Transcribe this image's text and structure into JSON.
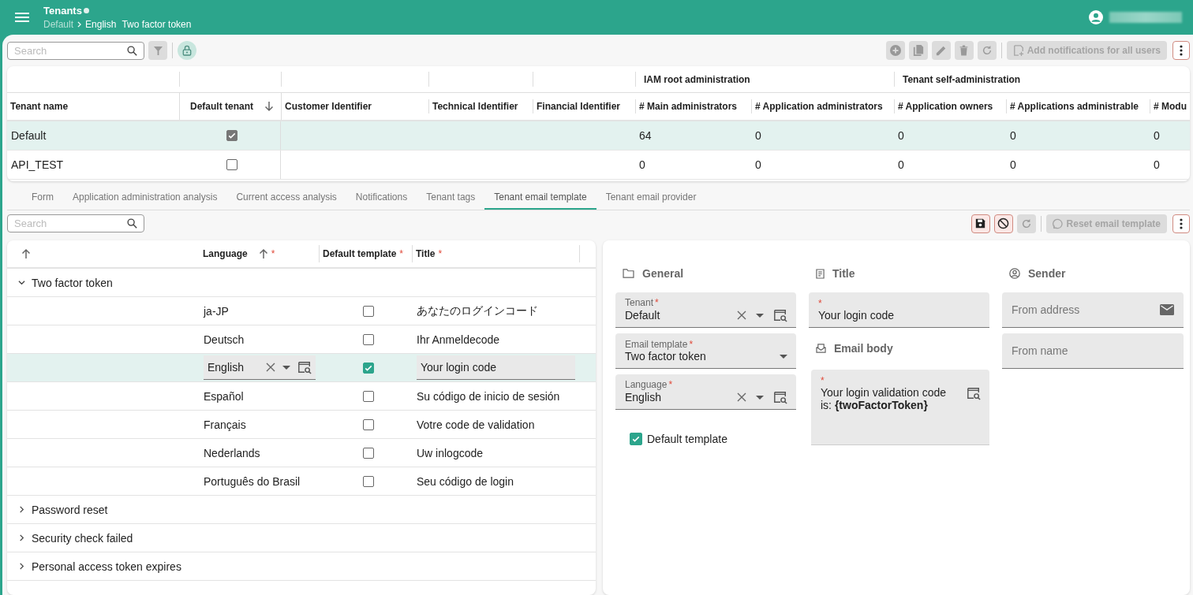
{
  "app_bar": {
    "title": "Tenants",
    "modified": true,
    "breadcrumb": [
      "Default",
      "English"
    ],
    "record": "Two factor token"
  },
  "toolbar": {
    "search": {
      "placeholder": "Search"
    },
    "filter": {
      "disabled": true
    },
    "lock": {
      "locked": true
    },
    "actions": [
      {
        "kind": "add",
        "disabled": true
      },
      {
        "kind": "copy",
        "disabled": true
      },
      {
        "kind": "edit",
        "disabled": true
      },
      {
        "kind": "delete",
        "disabled": true
      },
      {
        "kind": "refresh",
        "disabled": true
      }
    ],
    "add_notifications": {
      "label": "Add notifications for all users",
      "disabled": true
    }
  },
  "tenants_table": {
    "column_groups": [
      {
        "columns": [
          {
            "label": "Tenant name"
          }
        ]
      },
      {
        "columns": [
          {
            "label": "Default tenant",
            "sort_descending": true
          }
        ]
      },
      {
        "columns": [
          {
            "label": "Customer Identifier"
          }
        ]
      },
      {
        "columns": [
          {
            "label": "Technical Identifier"
          }
        ]
      },
      {
        "columns": [
          {
            "label": "Financial Identifier"
          }
        ]
      },
      {
        "label": "IAM root administration",
        "columns": [
          {
            "label": "# Main administrators"
          },
          {
            "label": "# Application administrators"
          }
        ]
      },
      {
        "label": "Tenant self-administration",
        "columns": [
          {
            "label": "# Application owners"
          },
          {
            "label": "# Applications administrable"
          },
          {
            "label": "# Modu"
          }
        ]
      }
    ],
    "rows": [
      {
        "tenant_name": "Default",
        "default_tenant": true,
        "selected": true,
        "main_administrators": "64",
        "application_administrators": "0",
        "application_owners": "0",
        "applications_administrable": "0",
        "column_10": "0"
      },
      {
        "tenant_name": "API_TEST",
        "default_tenant": false,
        "selected": false,
        "main_administrators": "0",
        "application_administrators": "0",
        "application_owners": "0",
        "applications_administrable": "0",
        "column_10": "0"
      }
    ]
  },
  "tabs": [
    {
      "label": "Form",
      "selected": false
    },
    {
      "label": "Application administration analysis",
      "selected": false
    },
    {
      "label": "Current access analysis",
      "selected": false
    },
    {
      "label": "Notifications",
      "selected": false
    },
    {
      "label": "Tenant tags",
      "selected": false
    },
    {
      "label": "Tenant email template",
      "selected": true
    },
    {
      "label": "Tenant email provider",
      "selected": false
    }
  ],
  "detail_toolbar": {
    "search": {
      "placeholder": "Search"
    },
    "save": {
      "disabled": false
    },
    "cancel": {
      "disabled": false
    },
    "refresh": {
      "disabled": true
    },
    "reset": {
      "label": "Reset email template",
      "disabled": true
    }
  },
  "templates_grid": {
    "columns": [
      {
        "sort_ascending": true
      },
      {
        "label": "Language",
        "sort_ascending": true,
        "required_mark": "*"
      },
      {
        "label": "Default template",
        "required_mark": "*"
      },
      {
        "label": "Title",
        "required_mark": "*"
      }
    ],
    "groups": [
      {
        "label": "Two factor token",
        "expanded": true,
        "children": [
          {
            "kind": "view",
            "language": "ja-JP",
            "default_template": false,
            "title": "あなたのログインコード",
            "selected": false
          },
          {
            "kind": "view",
            "language": "Deutsch",
            "default_template": false,
            "title": "Ihr Anmeldecode",
            "selected": false
          },
          {
            "kind": "edit",
            "language": "English",
            "default_template": true,
            "title": "Your login code",
            "selected": true
          },
          {
            "kind": "view",
            "language": "Español",
            "default_template": false,
            "title": "Su código de inicio de sesión",
            "selected": false
          },
          {
            "kind": "view",
            "language": "Français",
            "default_template": false,
            "title": "Votre code de validation",
            "selected": false
          },
          {
            "kind": "view",
            "language": "Nederlands",
            "default_template": false,
            "title": "Uw inlogcode",
            "selected": false
          },
          {
            "kind": "view",
            "language": "Português do Brasil",
            "default_template": false,
            "title": "Seu código de login",
            "selected": false
          }
        ]
      },
      {
        "label": "Password reset",
        "expanded": false
      },
      {
        "label": "Security check failed",
        "expanded": false
      },
      {
        "label": "Personal access token expires",
        "expanded": false
      }
    ]
  },
  "form": {
    "general": {
      "heading": "General",
      "tenant": {
        "label": "Tenant",
        "required_mark": "*",
        "value": "Default"
      },
      "email_template": {
        "label": "Email template",
        "required_mark": "*",
        "value": "Two factor token"
      },
      "language": {
        "label": "Language",
        "required_mark": "*",
        "value": "English"
      },
      "default_template": {
        "label": "Default template",
        "checked": true
      }
    },
    "title": {
      "heading": "Title",
      "field": {
        "required_mark": "*",
        "value": "Your login code"
      },
      "body_heading": "Email body",
      "body": {
        "required_mark": "*",
        "value": "Your login validation code is: **{twoFactorToken}**"
      }
    },
    "sender": {
      "heading": "Sender",
      "from_address": {
        "placeholder": "From address"
      },
      "from_name": {
        "placeholder": "From name"
      }
    }
  }
}
